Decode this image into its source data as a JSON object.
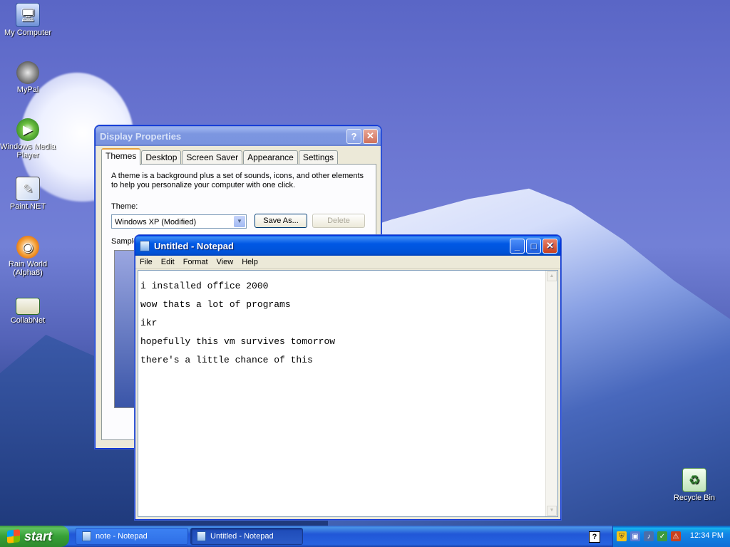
{
  "desktop": {
    "icons": [
      {
        "label": "My Computer"
      },
      {
        "label": "MyPal"
      },
      {
        "label": "Windows Media Player"
      },
      {
        "label": "Paint.NET"
      },
      {
        "label": "Rain World (Alpha8)"
      },
      {
        "label": "CollabNet"
      },
      {
        "label": "Recycle Bin"
      }
    ]
  },
  "display_properties": {
    "title": "Display Properties",
    "help_glyph": "?",
    "close_glyph": "✕",
    "tabs": [
      "Themes",
      "Desktop",
      "Screen Saver",
      "Appearance",
      "Settings"
    ],
    "description": "A theme is a background plus a set of sounds, icons, and other elements to help you personalize your computer with one click.",
    "theme_label": "Theme:",
    "theme_value": "Windows XP (Modified)",
    "save_as": "Save As...",
    "delete": "Delete",
    "sample_label": "Sample"
  },
  "notepad": {
    "title": "Untitled - Notepad",
    "minimize_glyph": "_",
    "maximize_glyph": "□",
    "close_glyph": "✕",
    "menu": [
      "File",
      "Edit",
      "Format",
      "View",
      "Help"
    ],
    "lines": [
      "i installed office 2000",
      "wow thats a lot of programs",
      "ikr",
      "hopefully this vm survives tomorrow",
      "there's a little chance of this"
    ]
  },
  "taskbar": {
    "start_label": "start",
    "tasks": [
      {
        "label": "note - Notepad",
        "active": false
      },
      {
        "label": "Untitled - Notepad",
        "active": true
      }
    ],
    "help_glyph": "?",
    "clock": "12:34 PM"
  },
  "colors": {
    "title_active": "#0058e5",
    "taskbar": "#2157d7",
    "start_button": "#37a037"
  }
}
